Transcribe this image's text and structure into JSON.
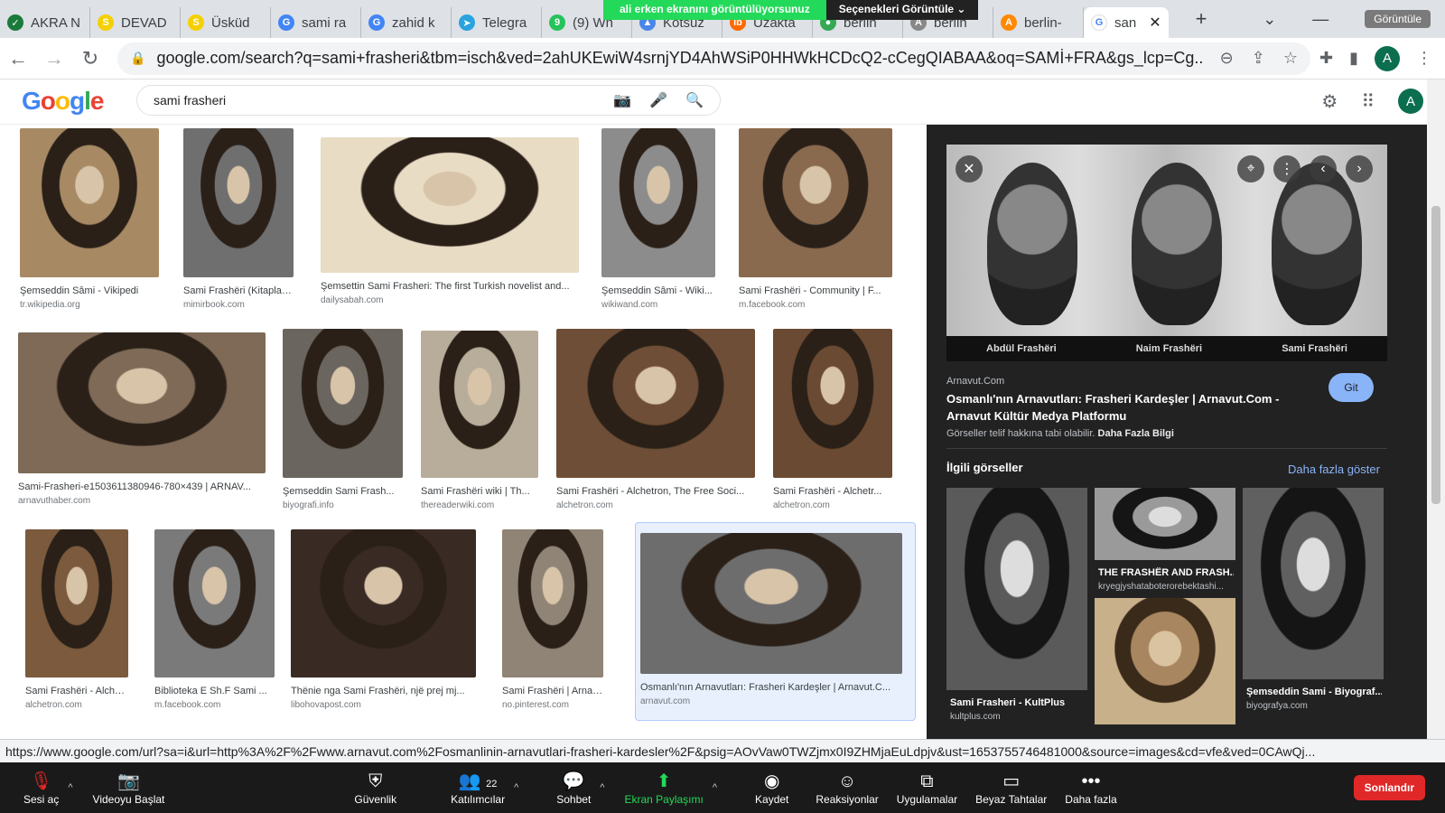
{
  "tabs": [
    {
      "label": "AKRA N",
      "color": "#1a7a3a",
      "glyph": "✓"
    },
    {
      "label": "DEVAD",
      "color": "#f5d000",
      "glyph": "S"
    },
    {
      "label": "Üsküd",
      "color": "#f5d000",
      "glyph": "S"
    },
    {
      "label": "sami ra",
      "color": "#4285f4",
      "glyph": "G"
    },
    {
      "label": "zahid k",
      "color": "#4285f4",
      "glyph": "G"
    },
    {
      "label": "Telegra",
      "color": "#2aa3df",
      "glyph": "➤"
    },
    {
      "label": "(9) Wh",
      "color": "#25c35a",
      "glyph": "9"
    },
    {
      "label": "Kotsuz",
      "color": "#4a86e8",
      "glyph": "▲"
    },
    {
      "label": "Uzakta",
      "color": "#ff6a00",
      "glyph": "ib"
    },
    {
      "label": "berlin",
      "color": "#34a853",
      "glyph": "●"
    },
    {
      "label": "berlin",
      "color": "#888888",
      "glyph": "A"
    },
    {
      "label": "berlin-",
      "color": "#ff8a00",
      "glyph": "A"
    }
  ],
  "active_tab": {
    "label": "san",
    "close": "✕"
  },
  "new_tab": "+",
  "share_banner": {
    "sharing": "ali erken ekranını görüntülüyorsunuz",
    "options": "Seçenekleri Görüntüle ⌄"
  },
  "window_button": "Görüntüle",
  "url": "google.com/search?q=sami+frasheri&tbm=isch&ved=2ahUKEwiW4srnjYD4AhWSiP0HHWkHCDcQ2-cCegQIABAA&oq=SAMİ+FRA&gs_lcp=Cg...",
  "profile_initial": "A",
  "logo": [
    "G",
    "o",
    "o",
    "g",
    "l",
    "e"
  ],
  "search_query": "sami frasheri",
  "images": [
    {
      "caption": "Şemseddin Sâmi - Vikipedi",
      "source": "tr.wikipedia.org",
      "bg": "#a78a64"
    },
    {
      "caption": "Sami Frashëri (Kitaplar ...",
      "source": "mimirbook.com",
      "bg": "#6f6f70"
    },
    {
      "caption": "Şemsettin Sami Frasheri: The first Turkish novelist and...",
      "source": "dailysabah.com",
      "bg": "#e9dcc5"
    },
    {
      "caption": "Şemseddin Sâmi - Wiki...",
      "source": "wikiwand.com",
      "bg": "#8c8c8c"
    },
    {
      "caption": "Sami Frashëri - Community | F...",
      "source": "m.facebook.com",
      "bg": "#8a6a4f"
    },
    {
      "caption": "Sami-Frasheri-e1503611380946-780×439 | ARNAV...",
      "source": "arnavuthaber.com",
      "bg": "#7e6a57"
    },
    {
      "caption": "Şemseddin Sami Frash...",
      "source": "biyografi.info",
      "bg": "#6a655e"
    },
    {
      "caption": "Sami Frashëri wiki | Th...",
      "source": "thereaderwiki.com",
      "bg": "#b8ad9a"
    },
    {
      "caption": "Sami Frashëri - Alchetron, The Free Soci...",
      "source": "alchetron.com",
      "bg": "#6e4e36"
    },
    {
      "caption": "Sami Frashëri - Alchetr...",
      "source": "alchetron.com",
      "bg": "#6a4a32"
    },
    {
      "caption": "Sami Frashëri - Alchetr...",
      "source": "alchetron.com",
      "bg": "#7b5a3d"
    },
    {
      "caption": "Biblioteka E Sh.F Sami ...",
      "source": "m.facebook.com",
      "bg": "#7a7a7a"
    },
    {
      "caption": "Thënie nga Sami Frashëri, një prej mj...",
      "source": "libohovapost.com",
      "bg": "#3a2a24"
    },
    {
      "caption": "Sami Frashëri | Arnavut...",
      "source": "no.pinterest.com",
      "bg": "#8f8475"
    },
    {
      "caption": "Osmanlı'nın Arnavutları: Frasheri Kardeşler | Arnavut.C...",
      "source": "arnavut.com",
      "bg": "#6d6d6d"
    }
  ],
  "panel": {
    "names": [
      "Abdül Frashëri",
      "Naim Frashëri",
      "Sami Frashëri"
    ],
    "site": "Arnavut.Com",
    "title": "Osmanlı'nın Arnavutları: Frasheri Kardeşler | Arnavut.Com - Arnavut Kültür Medya Platformu",
    "visit": "Git",
    "license_text": "Görseller telif hakkına tabi olabilir.",
    "license_link": "Daha Fazla Bilgi",
    "related_heading": "İlgili görseller",
    "more": "Daha fazla göster",
    "related": [
      {
        "caption": "Sami Frasheri - KultPlus",
        "source": "kultplus.com",
        "bg": "#5a5a5a"
      },
      {
        "caption": "THE FRASHËR AND FRASH...",
        "source": "kryegjyshataboterorebektashi...",
        "bg": "#9a9a9a"
      },
      {
        "caption": "Şemseddin Sami - Biyograf...",
        "source": "biyografya.com",
        "bg": "#606060"
      }
    ]
  },
  "status_url": "https://www.google.com/url?sa=i&url=http%3A%2F%2Fwww.arnavut.com%2Fosmanlinin-arnavutlari-frasheri-kardesler%2F&psig=AOvVaw0TWZjmx0I9ZHMjaEuLdpjv&ust=1653755746481000&source=images&cd=vfe&ved=0CAwQj...",
  "zoom": {
    "mute": "Sesi aç",
    "video": "Videoyu Başlat",
    "security": "Güvenlik",
    "participants": "Katılımcılar",
    "participants_count": "22",
    "chat": "Sohbet",
    "share": "Ekran Paylaşımı",
    "record": "Kaydet",
    "reactions": "Reaksiyonlar",
    "apps": "Uygulamalar",
    "whiteboard": "Beyaz Tahtalar",
    "more": "Daha fazla",
    "end": "Sonlandır"
  }
}
